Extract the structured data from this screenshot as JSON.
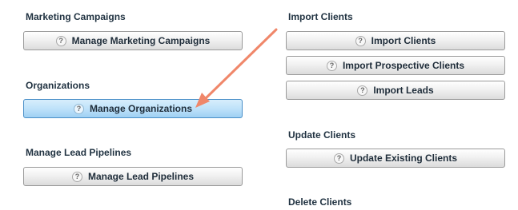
{
  "help_glyph": "?",
  "left": {
    "marketing": {
      "title": "Marketing Campaigns",
      "button": "Manage Marketing Campaigns"
    },
    "organizations": {
      "title": "Organizations",
      "button": "Manage Organizations"
    },
    "pipelines": {
      "title": "Manage Lead Pipelines",
      "button": "Manage Lead Pipelines"
    }
  },
  "right": {
    "import": {
      "title": "Import Clients",
      "buttons": [
        "Import Clients",
        "Import Prospective Clients",
        "Import Leads"
      ]
    },
    "update": {
      "title": "Update Clients",
      "button": "Update Existing Clients"
    },
    "delete": {
      "title": "Delete Clients"
    }
  },
  "colors": {
    "active_button": "#bfe2fa",
    "annotation_arrow": "#f0876a"
  }
}
